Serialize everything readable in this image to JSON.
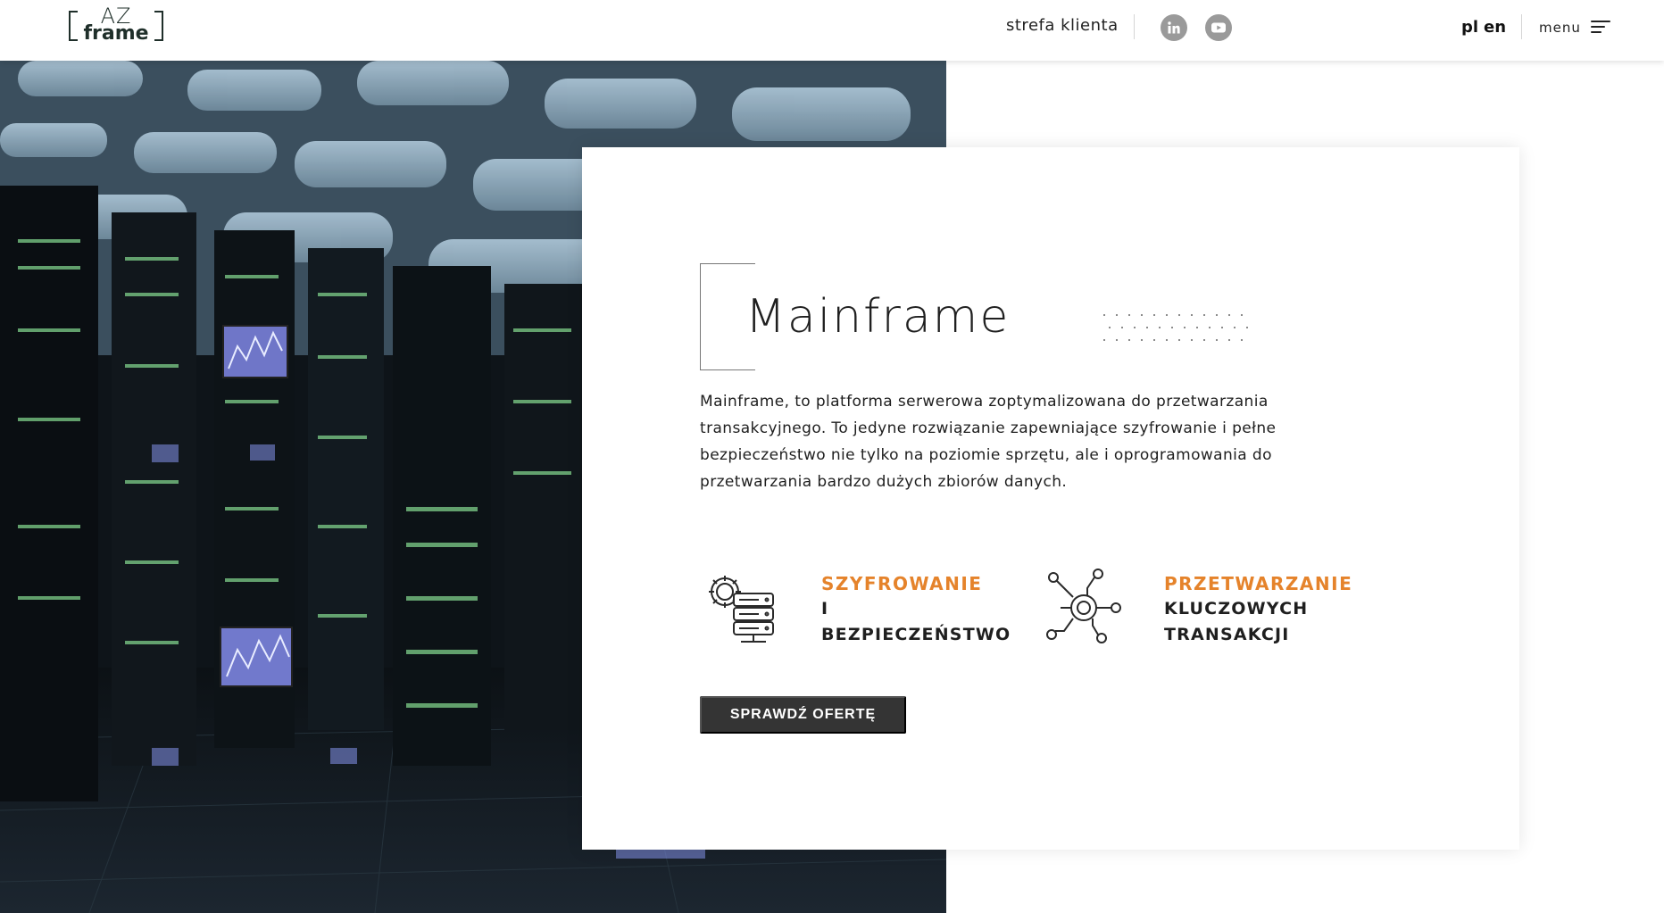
{
  "header": {
    "logo_top": "AZ",
    "logo_bottom": "frame",
    "client_zone": "strefa klienta",
    "social": [
      "linkedin-icon",
      "youtube-icon"
    ],
    "lang_pl": "pl",
    "lang_en": "en",
    "menu_label": "menu"
  },
  "hero": {
    "image": "data-center-server-racks"
  },
  "card": {
    "title": "Mainframe",
    "description": "Mainframe, to platforma serwerowa zoptymalizowana do przetwarzania transakcyjnego. To jedyne rozwiązanie zapewniające szyfrowanie i pełne bezpieczeństwo nie tylko na poziomie sprzętu, ale i oprogramowania do przetwarzania bardzo dużych zbiorów danych.",
    "features": [
      {
        "icon": "server-gear-icon",
        "line1": "SZYFROWANIE",
        "line2": "I",
        "line3": "BEZPIECZEŃSTWO"
      },
      {
        "icon": "network-processing-icon",
        "line1": "PRZETWARZANIE",
        "line2": "KLUCZOWYCH",
        "line3": "TRANSAKCJI"
      }
    ],
    "cta": "SPRAWDŹ OFERTĘ"
  },
  "colors": {
    "accent": "#e5832b",
    "button": "#343434",
    "text": "#1f1f1f"
  }
}
